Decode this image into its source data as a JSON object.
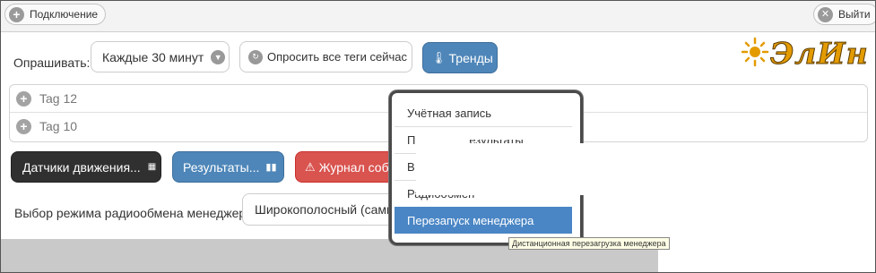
{
  "topbar": {
    "connect_label": "Подключение",
    "logout_label": "Выйти"
  },
  "poll": {
    "label": "Опрашивать:",
    "interval_value": "Каждые 30 минут",
    "poll_all_label": "Опросить все теги сейчас",
    "trends_label": "Тренды"
  },
  "logo": {
    "text": "ЭлИн"
  },
  "tags": [
    {
      "label": "Tag 12"
    },
    {
      "label": "Tag 10"
    }
  ],
  "actions": {
    "sensors_label": "Датчики движения...",
    "results_label": "Результаты...",
    "events_label": "Журнал собы"
  },
  "radio": {
    "label": "Выбор режима радиообмена менеджера:",
    "mode_value": "Широкополосный (самый"
  },
  "menu": {
    "items": [
      {
        "label": "Учётная запись"
      },
      {
        "label": "П"
      },
      {
        "label": "В"
      },
      {
        "label": "Радиообмен"
      },
      {
        "label": "Перезапуск менеджера"
      }
    ],
    "partial_text": "езультаты"
  },
  "tooltip": "Дистанционная перезагрузка менеджера",
  "colors": {
    "primary": "#4e86b9",
    "dark": "#303030",
    "danger": "#d9534f",
    "menu_active": "#4a86c5",
    "logo": "#e39b00"
  }
}
